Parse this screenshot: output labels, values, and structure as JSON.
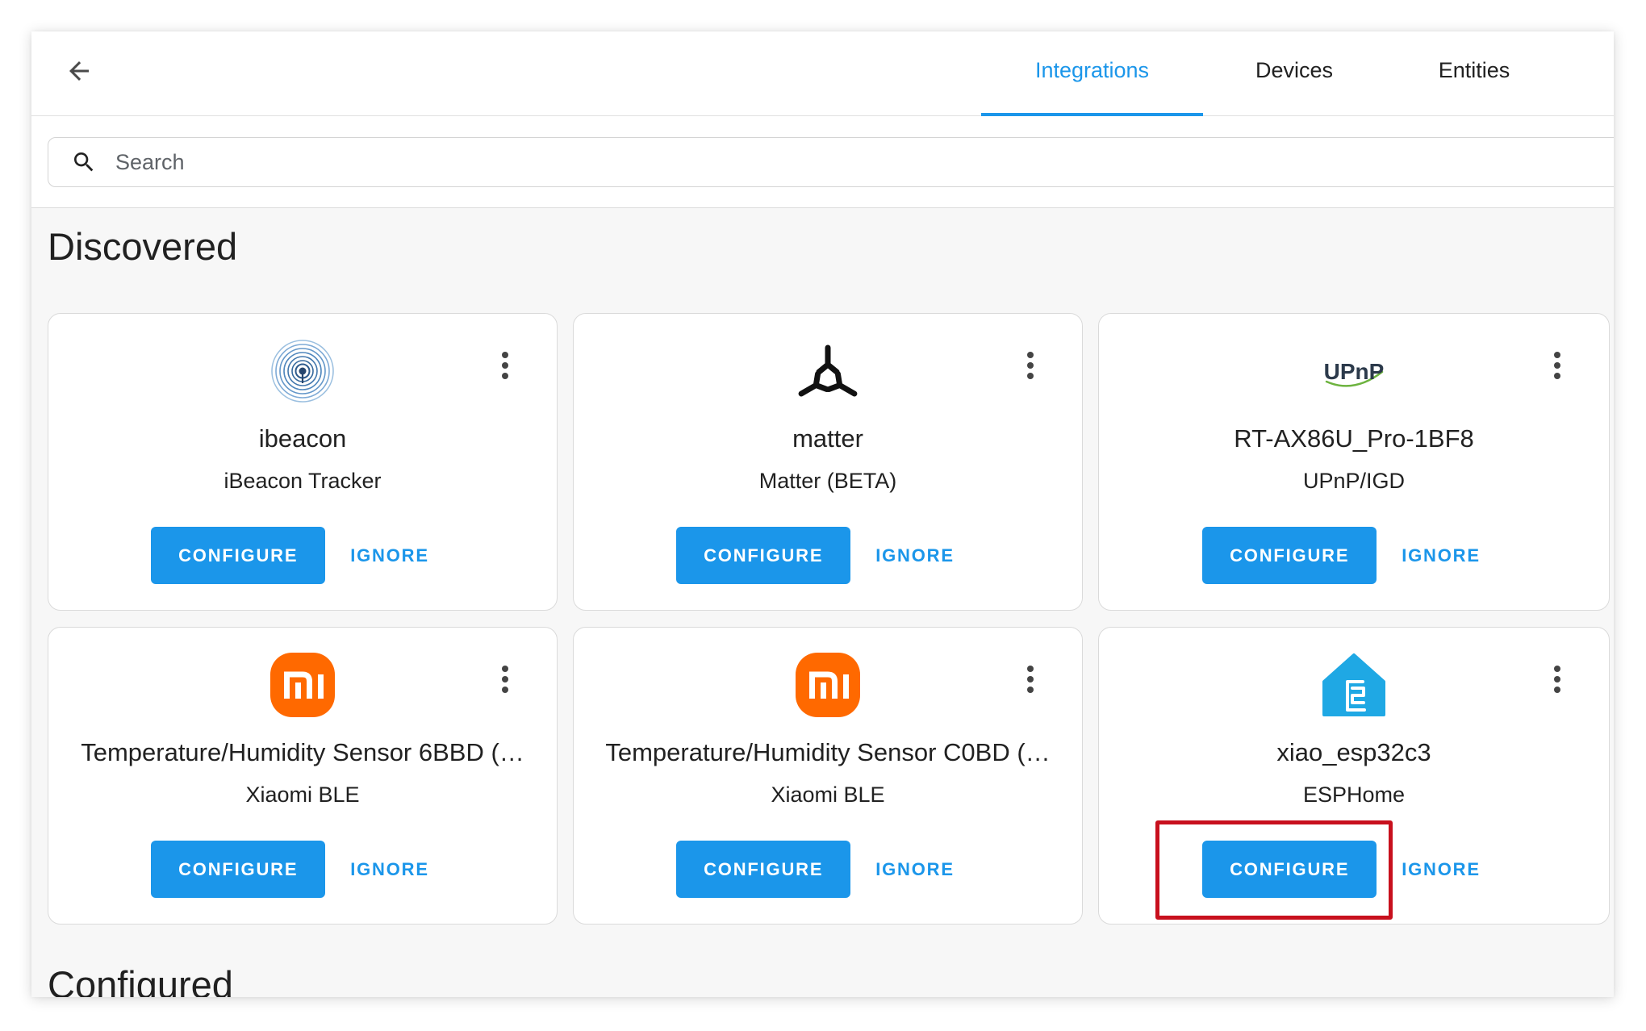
{
  "header": {
    "back_icon": "back-arrow-icon",
    "tabs": [
      {
        "label": "Integrations",
        "active": true
      },
      {
        "label": "Devices",
        "active": false
      },
      {
        "label": "Entities",
        "active": false
      }
    ]
  },
  "search": {
    "icon": "search-icon",
    "placeholder": "Search",
    "value": ""
  },
  "discovered": {
    "heading": "Discovered",
    "cards": [
      {
        "icon": "ibeacon-icon",
        "title": "ibeacon",
        "subtitle": "iBeacon Tracker",
        "configure_label": "CONFIGURE",
        "ignore_label": "IGNORE"
      },
      {
        "icon": "matter-icon",
        "title": "matter",
        "subtitle": "Matter (BETA)",
        "configure_label": "CONFIGURE",
        "ignore_label": "IGNORE"
      },
      {
        "icon": "upnp-icon",
        "logo_text": "UPnP",
        "title": "RT-AX86U_Pro-1BF8",
        "subtitle": "UPnP/IGD",
        "configure_label": "CONFIGURE",
        "ignore_label": "IGNORE"
      },
      {
        "icon": "xiaomi-icon",
        "title": "Temperature/Humidity Sensor 6BBD (…",
        "subtitle": "Xiaomi BLE",
        "configure_label": "CONFIGURE",
        "ignore_label": "IGNORE"
      },
      {
        "icon": "xiaomi-icon",
        "title": "Temperature/Humidity Sensor C0BD (…",
        "subtitle": "Xiaomi BLE",
        "configure_label": "CONFIGURE",
        "ignore_label": "IGNORE"
      },
      {
        "icon": "esphome-icon",
        "title": "xiao_esp32c3",
        "subtitle": "ESPHome",
        "configure_label": "CONFIGURE",
        "ignore_label": "IGNORE"
      }
    ]
  },
  "configured": {
    "heading": "Configured"
  },
  "card_menu_icon": "more-options-icon",
  "colors": {
    "primary": "#1b96ea",
    "highlight": "#c8101d",
    "xiaomi": "#ff6900",
    "esphome": "#1fa8e4",
    "text": "#212121"
  }
}
